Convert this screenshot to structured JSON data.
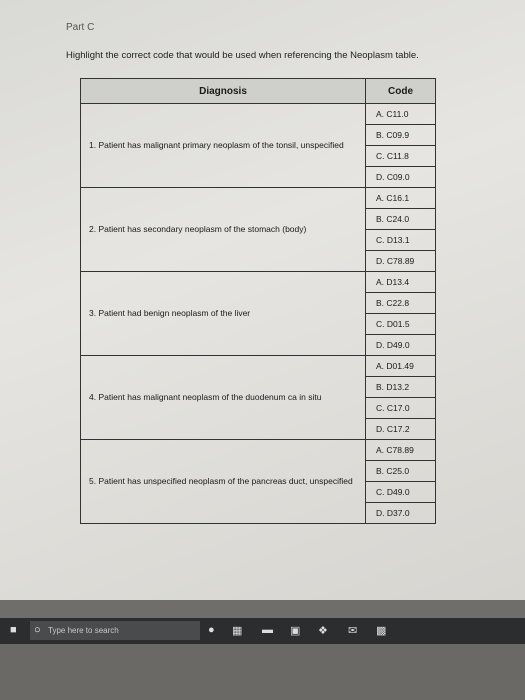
{
  "part_label": "Part C",
  "instruction": "Highlight the correct code that would be used when referencing the Neoplasm table.",
  "table": {
    "headers": {
      "diagnosis": "Diagnosis",
      "code": "Code"
    },
    "questions": [
      {
        "text": "1. Patient has malignant primary neoplasm of the tonsil, unspecified",
        "options": [
          "A. C11.0",
          "B. C09.9",
          "C. C11.8",
          "D. C09.0"
        ]
      },
      {
        "text": "2. Patient has secondary neoplasm of the stomach (body)",
        "options": [
          "A. C16.1",
          "B. C24.0",
          "C. D13.1",
          "D. C78.89"
        ]
      },
      {
        "text": "3. Patient had benign neoplasm of the liver",
        "options": [
          "A. D13.4",
          "B. C22.8",
          "C. D01.5",
          "D. D49.0"
        ]
      },
      {
        "text": "4. Patient has malignant neoplasm of the duodenum ca in situ",
        "options": [
          "A. D01.49",
          "B. D13.2",
          "C. C17.0",
          "D. C17.2"
        ]
      },
      {
        "text": "5. Patient has unspecified neoplasm of the pancreas duct, unspecified",
        "options": [
          "A. C78.89",
          "B. C25.0",
          "C. D49.0",
          "D. D37.0"
        ]
      }
    ]
  },
  "taskbar": {
    "search_placeholder": "Type here to search"
  }
}
